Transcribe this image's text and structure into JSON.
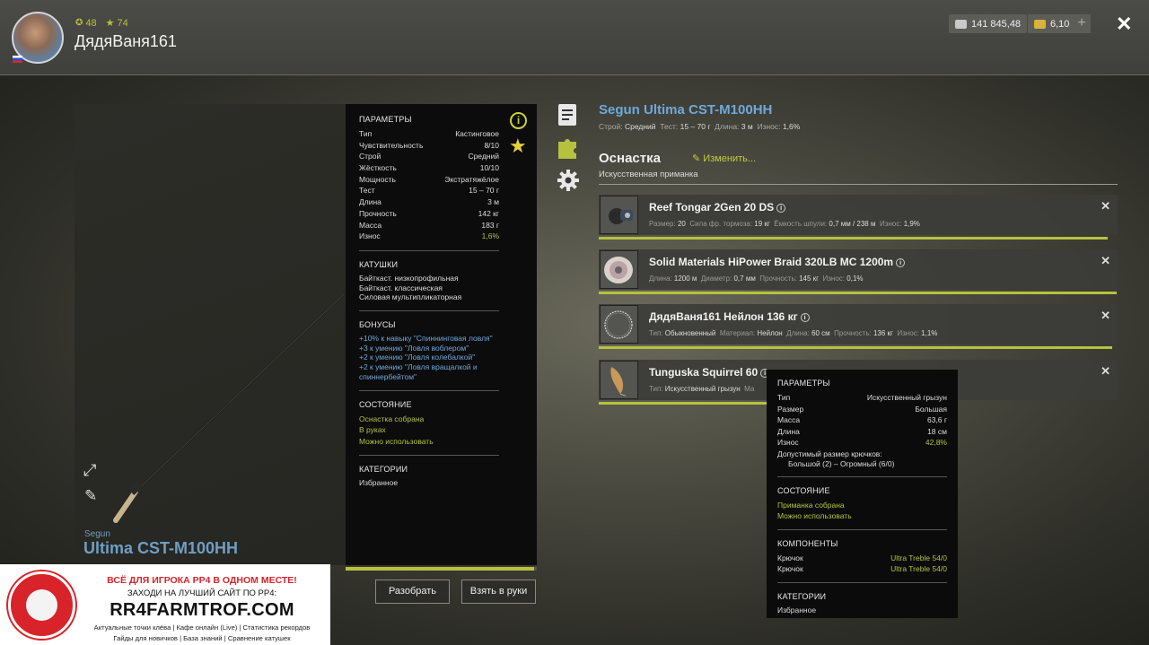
{
  "player": {
    "name": "ДядяВаня161",
    "level": "48",
    "rank": "74"
  },
  "currency": {
    "silver": "141 845,48",
    "gold": "6,10",
    "plus": "+"
  },
  "rod": {
    "brand": "Segun",
    "model": "Ultima CST-M100HH",
    "title": "Segun Ultima CST-M100HH",
    "sub": {
      "action_label": "Строй:",
      "action": "Средний",
      "test_label": "Тест:",
      "test": "15 – 70 г",
      "length_label": "Длина:",
      "length": "3 м",
      "wear_label": "Износ:",
      "wear": "1,6%"
    },
    "params_title": "ПАРАМЕТРЫ",
    "params": [
      {
        "k": "Тип",
        "v": "Кастинговое"
      },
      {
        "k": "Чувствительность",
        "v": "8/10"
      },
      {
        "k": "Строй",
        "v": "Средний"
      },
      {
        "k": "Жёсткость",
        "v": "10/10"
      },
      {
        "k": "Мощность",
        "v": "Экстратяжёлое"
      },
      {
        "k": "Тест",
        "v": "15 – 70 г"
      },
      {
        "k": "Длина",
        "v": "3 м"
      },
      {
        "k": "Прочность",
        "v": "142 кг"
      },
      {
        "k": "Масса",
        "v": "183 г"
      },
      {
        "k": "Износ",
        "v": "1,6%"
      }
    ],
    "reels_title": "КАТУШКИ",
    "reels": [
      "Байткаст. низкопрофильная",
      "Байткаст. классическая",
      "Силовая мультипликаторная"
    ],
    "bonuses_title": "БОНУСЫ",
    "bonuses": [
      "+10% к навыку \"Спиннинговая ловля\"",
      "+3 к умению \"Ловля воблером\"",
      "+2 к умению \"Ловля колебалкой\"",
      "+2 к умению \"Ловля вращалкой и",
      "спиннербейтом\""
    ],
    "state_title": "СОСТОЯНИЕ",
    "states": [
      "Оснастка собрана",
      "В руках",
      "Можно использовать"
    ],
    "categories_title": "КАТЕГОРИИ",
    "category": "Избранное",
    "condition": 0.984
  },
  "buttons": {
    "disassemble": "Разобрать",
    "take": "Взять в руки"
  },
  "rig": {
    "title": "Оснастка",
    "change": "Изменить...",
    "bait_type": "Искусственная приманка",
    "items": [
      {
        "name": "Reef Tongar 2Gen 20 DS",
        "info": [
          {
            "k": "Размер:",
            "v": "20"
          },
          {
            "k": "Сила фр. тормоза:",
            "v": "19 кг"
          },
          {
            "k": "Ёмкость шпули:",
            "v": "0,7 мм / 238 м"
          },
          {
            "k": "Износ:",
            "v": "1,9%"
          }
        ],
        "condition": 0.981
      },
      {
        "name": "Solid Materials HiPower Braid 320LB MC 1200m",
        "info": [
          {
            "k": "Длина:",
            "v": "1200 м"
          },
          {
            "k": "Диаметр:",
            "v": "0,7 мм"
          },
          {
            "k": "Прочность:",
            "v": "145 кг"
          },
          {
            "k": "Износ:",
            "v": "0,1%"
          }
        ],
        "condition": 0.999
      },
      {
        "name": "ДядяВаня161 Нейлон 136 кг",
        "info": [
          {
            "k": "Тип:",
            "v": "Обыкновенный"
          },
          {
            "k": "Материал:",
            "v": "Нейлон"
          },
          {
            "k": "Длина:",
            "v": "60 см"
          },
          {
            "k": "Прочность:",
            "v": "136 кг"
          },
          {
            "k": "Износ:",
            "v": "1,1%"
          }
        ],
        "condition": 0.989
      },
      {
        "name": "Tunguska Squirrel 60",
        "info": [
          {
            "k": "Тип:",
            "v": "Искусственный грызун"
          },
          {
            "k": "Ма",
            "v": ""
          }
        ],
        "condition": 0.572
      }
    ]
  },
  "tooltip": {
    "params_title": "ПАРАМЕТРЫ",
    "params": [
      {
        "k": "Тип",
        "v": "Искусственный грызун"
      },
      {
        "k": "Размер",
        "v": "Большая"
      },
      {
        "k": "Масса",
        "v": "63,6 г"
      },
      {
        "k": "Длина",
        "v": "18 см"
      },
      {
        "k": "Износ",
        "v": "42,8%"
      }
    ],
    "hook_size_label": "Допустимый размер крючков:",
    "hook_size": "Большой (2) – Огромный (6/0)",
    "state_title": "СОСТОЯНИЕ",
    "states": [
      "Приманка собрана",
      "Можно использовать"
    ],
    "components_title": "КОМПОНЕНТЫ",
    "components": [
      {
        "k": "Крючок",
        "v": "Ultra Treble 54/0"
      },
      {
        "k": "Крючок",
        "v": "Ultra Treble 54/0"
      }
    ],
    "categories_title": "КАТЕГОРИИ",
    "category": "Избранное"
  },
  "banner": {
    "line1": "ВСЁ ДЛЯ ИГРОКА РР4 В ОДНОМ МЕСТЕ!",
    "line2": "ЗАХОДИ НА ЛУЧШИЙ САЙТ ПО РР4:",
    "site": "RR4FARMTROF.COM",
    "line4": "Актуальные точки клёва  |  Кафе онлайн (Live)  |  Статистика рекордов",
    "line5": "Гайды для новичков  |  База знаний  |  Сравнение катушек"
  },
  "colors": {
    "accent_blue": "#6fa8dc",
    "accent_green": "#b6c23e",
    "brand_red": "#d8232a"
  }
}
